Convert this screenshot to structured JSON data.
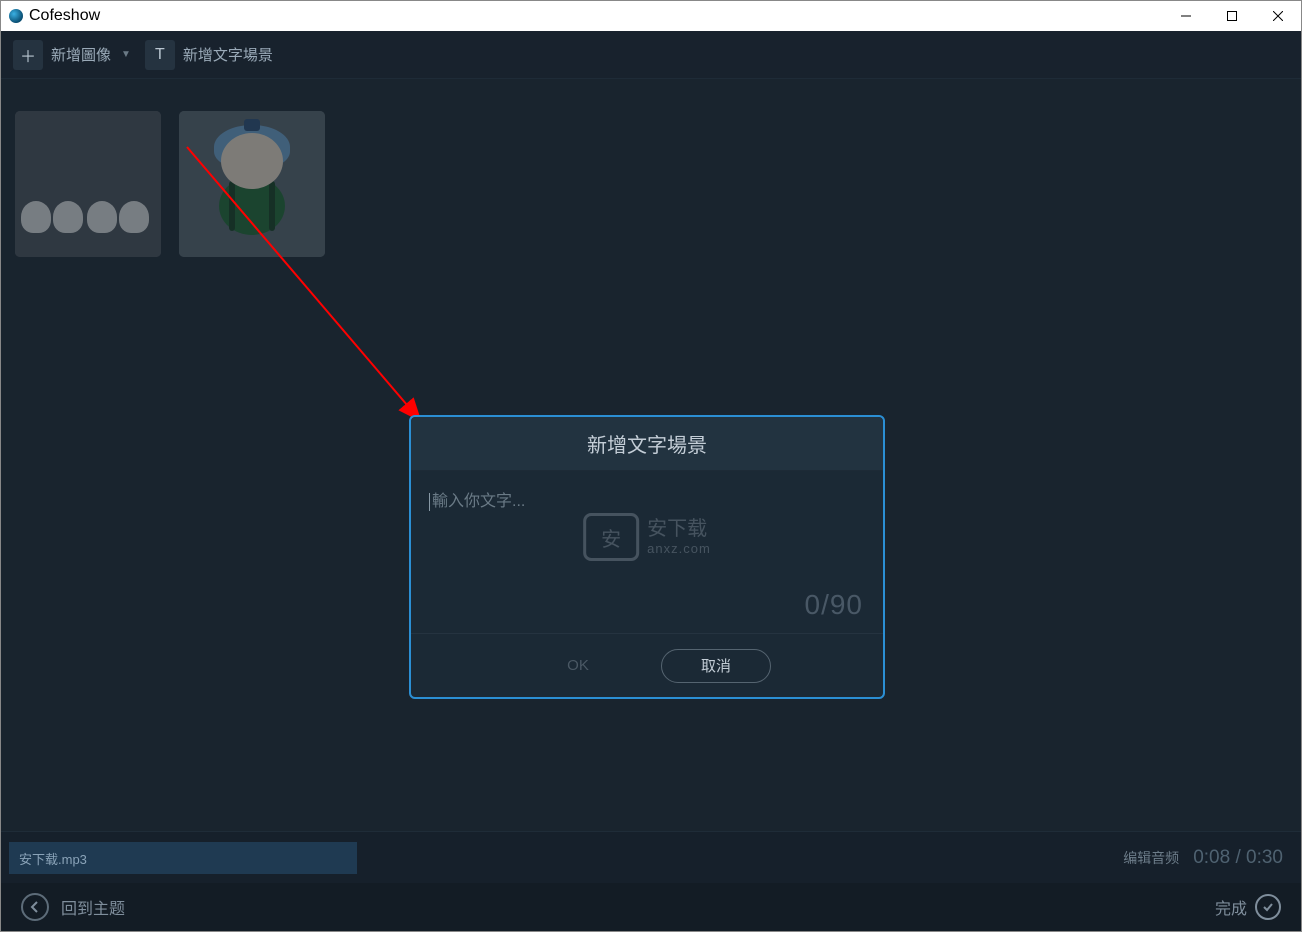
{
  "window": {
    "title": "Cofeshow"
  },
  "toolbar": {
    "addImage": "新增圖像",
    "addTextScene": "新增文字場景"
  },
  "dialog": {
    "title": "新增文字場景",
    "placeholder": "輸入你文字...",
    "counter": "0/90",
    "ok": "OK",
    "cancel": "取消"
  },
  "watermark": {
    "badge": "安",
    "text": "安下载",
    "sub": "anxz.com"
  },
  "audio": {
    "trackName": "安下载.mp3",
    "editLabel": "编辑音频",
    "current": "0:08",
    "total": "0:30"
  },
  "footer": {
    "back": "回到主题",
    "done": "完成"
  }
}
